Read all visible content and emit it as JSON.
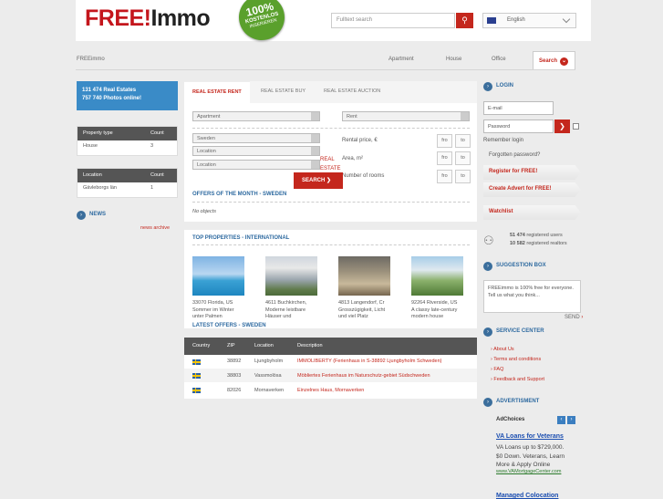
{
  "header": {
    "logo_red": "FREE!",
    "logo_dark": "Immo",
    "badge_pct": "100%",
    "badge_l1": "KOSTENLOS",
    "badge_l2": "INSERIEREN",
    "search_placeholder": "Fulltext search",
    "language": "English"
  },
  "nav": {
    "breadcrumb": "FREEimmo",
    "items": [
      "Apartment",
      "House",
      "Office"
    ],
    "active": "Search"
  },
  "left": {
    "stats_line1": "131 474  Real Estates",
    "stats_line2": "757 740  Photos online!",
    "prop_table": {
      "headers": [
        "Property type",
        "Count"
      ],
      "rows": [
        [
          "House",
          "3"
        ]
      ]
    },
    "loc_table": {
      "headers": [
        "Location",
        "Count"
      ],
      "rows": [
        [
          "Gävleborgs län",
          "1"
        ]
      ]
    },
    "news_title": "NEWS",
    "news_archive": "news archive"
  },
  "tabs": [
    "REAL ESTATE RENT",
    "REAL ESTATE BUY",
    "REAL ESTATE AUCTION"
  ],
  "form": {
    "type": "Apartment",
    "mode": "Rent",
    "country": "Sweden",
    "loc1": "Location",
    "loc2": "Location",
    "rental": "Rental price, €",
    "area": "Area, m²",
    "rooms": "Number of rooms",
    "fro": "fro",
    "to": "to",
    "ad_real": "REAL",
    "ad_estate": "ESTATE",
    "search_btn": "SEARCH"
  },
  "offers": {
    "title": "OFFERS OF THE MONTH - SWEDEN",
    "empty": "No objects"
  },
  "top": {
    "title": "TOP PROPERTIES - INTERNATIONAL",
    "items": [
      {
        "loc": "33070 Florida, US",
        "desc1": "Sommer im Winter",
        "desc2": "unter Palmen"
      },
      {
        "loc": "4611 Buchkirchen,",
        "desc1": "Moderne leistbare",
        "desc2": "Häuser und"
      },
      {
        "loc": "4813 Langendorf, Cr",
        "desc1": "Grosszügigkeit, Licht",
        "desc2": "und viel Platz"
      },
      {
        "loc": "92264 Riverside, US",
        "desc1": "A classy late-century",
        "desc2": "modern house"
      }
    ]
  },
  "latest": {
    "title": "LATEST OFFERS - SWEDEN",
    "headers": [
      "Country",
      "ZIP",
      "Location",
      "Description"
    ],
    "rows": [
      {
        "zip": "38892",
        "loc": "Ljungbyholm",
        "desc": "IMMOLIBERTY (Ferienhaus in S-38892 Ljungbyholm Schweden)"
      },
      {
        "zip": "38803",
        "loc": "Vassmolösa",
        "desc": "Möbliertes Ferienhaus im Naturschutz-gebiet Südschweden"
      },
      {
        "zip": "82026",
        "loc": "Mornaverken",
        "desc": "Einzelnes Haus, Mornaverken"
      }
    ]
  },
  "right": {
    "login_title": "LOGIN",
    "email": "E-mail",
    "password": "Password",
    "remember": "Remember login",
    "forgot": "Forgotten password?",
    "btn_register": "Register for FREE!",
    "btn_advert": "Create Advert for FREE!",
    "btn_watch": "Watchlist",
    "users": "51 474",
    "users_lbl": "registered users",
    "realtors": "10 582",
    "realtors_lbl": "registered realtors",
    "suggestion_title": "SUGGESTION BOX",
    "suggestion_text": "FREEimmo is 100% free for everyone. Tell us what you think...",
    "send": "SEND",
    "service_title": "SERVICE CENTER",
    "service_items": [
      "About Us",
      "Terms and conditions",
      "FAQ",
      "Feedback and Support"
    ],
    "ad_title": "ADVERTISMENT",
    "adchoices": "AdChoices",
    "ad_head": "VA Loans for Veterans",
    "ad_l1": "VA Loans up to $729,000.",
    "ad_l2": "$0 Down. Veterans, Learn",
    "ad_l3": "More & Apply Online",
    "ad_url": "www.VAMortgageCenter.com",
    "ad_next": "Managed Colocation"
  }
}
